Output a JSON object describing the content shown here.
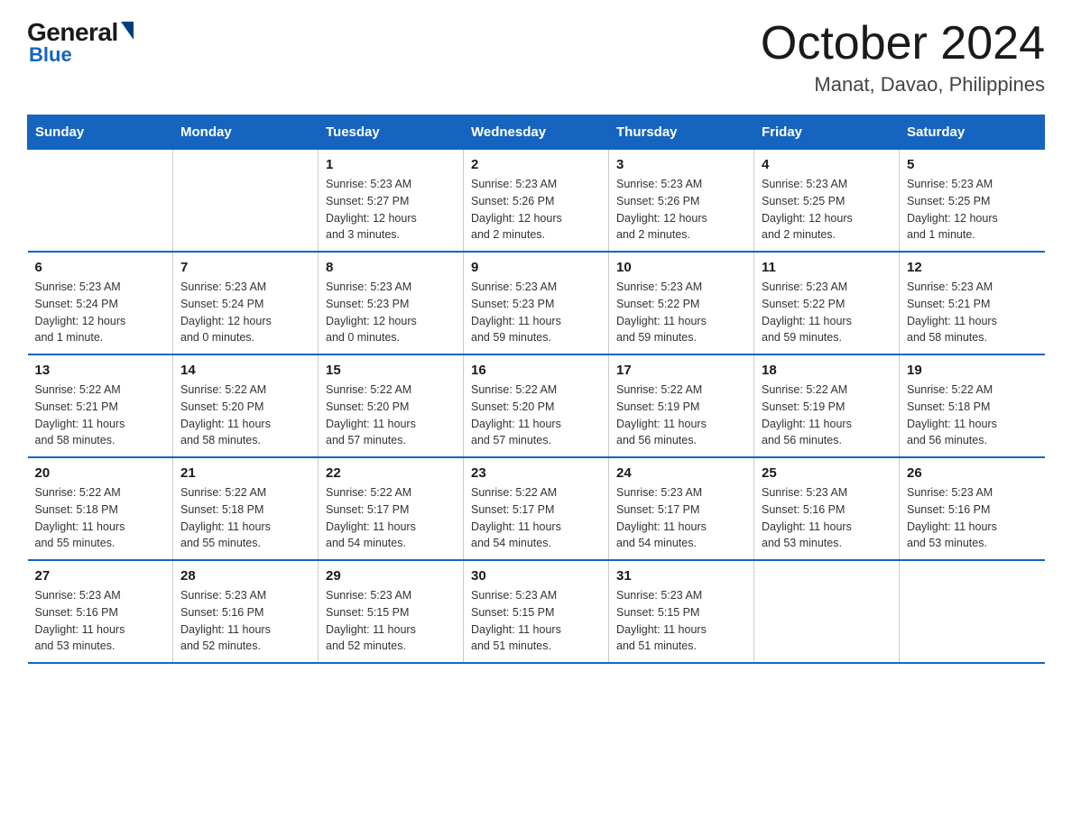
{
  "logo": {
    "general": "General",
    "blue": "Blue"
  },
  "title": "October 2024",
  "subtitle": "Manat, Davao, Philippines",
  "days_header": [
    "Sunday",
    "Monday",
    "Tuesday",
    "Wednesday",
    "Thursday",
    "Friday",
    "Saturday"
  ],
  "weeks": [
    [
      {
        "day": "",
        "info": ""
      },
      {
        "day": "",
        "info": ""
      },
      {
        "day": "1",
        "info": "Sunrise: 5:23 AM\nSunset: 5:27 PM\nDaylight: 12 hours\nand 3 minutes."
      },
      {
        "day": "2",
        "info": "Sunrise: 5:23 AM\nSunset: 5:26 PM\nDaylight: 12 hours\nand 2 minutes."
      },
      {
        "day": "3",
        "info": "Sunrise: 5:23 AM\nSunset: 5:26 PM\nDaylight: 12 hours\nand 2 minutes."
      },
      {
        "day": "4",
        "info": "Sunrise: 5:23 AM\nSunset: 5:25 PM\nDaylight: 12 hours\nand 2 minutes."
      },
      {
        "day": "5",
        "info": "Sunrise: 5:23 AM\nSunset: 5:25 PM\nDaylight: 12 hours\nand 1 minute."
      }
    ],
    [
      {
        "day": "6",
        "info": "Sunrise: 5:23 AM\nSunset: 5:24 PM\nDaylight: 12 hours\nand 1 minute."
      },
      {
        "day": "7",
        "info": "Sunrise: 5:23 AM\nSunset: 5:24 PM\nDaylight: 12 hours\nand 0 minutes."
      },
      {
        "day": "8",
        "info": "Sunrise: 5:23 AM\nSunset: 5:23 PM\nDaylight: 12 hours\nand 0 minutes."
      },
      {
        "day": "9",
        "info": "Sunrise: 5:23 AM\nSunset: 5:23 PM\nDaylight: 11 hours\nand 59 minutes."
      },
      {
        "day": "10",
        "info": "Sunrise: 5:23 AM\nSunset: 5:22 PM\nDaylight: 11 hours\nand 59 minutes."
      },
      {
        "day": "11",
        "info": "Sunrise: 5:23 AM\nSunset: 5:22 PM\nDaylight: 11 hours\nand 59 minutes."
      },
      {
        "day": "12",
        "info": "Sunrise: 5:23 AM\nSunset: 5:21 PM\nDaylight: 11 hours\nand 58 minutes."
      }
    ],
    [
      {
        "day": "13",
        "info": "Sunrise: 5:22 AM\nSunset: 5:21 PM\nDaylight: 11 hours\nand 58 minutes."
      },
      {
        "day": "14",
        "info": "Sunrise: 5:22 AM\nSunset: 5:20 PM\nDaylight: 11 hours\nand 58 minutes."
      },
      {
        "day": "15",
        "info": "Sunrise: 5:22 AM\nSunset: 5:20 PM\nDaylight: 11 hours\nand 57 minutes."
      },
      {
        "day": "16",
        "info": "Sunrise: 5:22 AM\nSunset: 5:20 PM\nDaylight: 11 hours\nand 57 minutes."
      },
      {
        "day": "17",
        "info": "Sunrise: 5:22 AM\nSunset: 5:19 PM\nDaylight: 11 hours\nand 56 minutes."
      },
      {
        "day": "18",
        "info": "Sunrise: 5:22 AM\nSunset: 5:19 PM\nDaylight: 11 hours\nand 56 minutes."
      },
      {
        "day": "19",
        "info": "Sunrise: 5:22 AM\nSunset: 5:18 PM\nDaylight: 11 hours\nand 56 minutes."
      }
    ],
    [
      {
        "day": "20",
        "info": "Sunrise: 5:22 AM\nSunset: 5:18 PM\nDaylight: 11 hours\nand 55 minutes."
      },
      {
        "day": "21",
        "info": "Sunrise: 5:22 AM\nSunset: 5:18 PM\nDaylight: 11 hours\nand 55 minutes."
      },
      {
        "day": "22",
        "info": "Sunrise: 5:22 AM\nSunset: 5:17 PM\nDaylight: 11 hours\nand 54 minutes."
      },
      {
        "day": "23",
        "info": "Sunrise: 5:22 AM\nSunset: 5:17 PM\nDaylight: 11 hours\nand 54 minutes."
      },
      {
        "day": "24",
        "info": "Sunrise: 5:23 AM\nSunset: 5:17 PM\nDaylight: 11 hours\nand 54 minutes."
      },
      {
        "day": "25",
        "info": "Sunrise: 5:23 AM\nSunset: 5:16 PM\nDaylight: 11 hours\nand 53 minutes."
      },
      {
        "day": "26",
        "info": "Sunrise: 5:23 AM\nSunset: 5:16 PM\nDaylight: 11 hours\nand 53 minutes."
      }
    ],
    [
      {
        "day": "27",
        "info": "Sunrise: 5:23 AM\nSunset: 5:16 PM\nDaylight: 11 hours\nand 53 minutes."
      },
      {
        "day": "28",
        "info": "Sunrise: 5:23 AM\nSunset: 5:16 PM\nDaylight: 11 hours\nand 52 minutes."
      },
      {
        "day": "29",
        "info": "Sunrise: 5:23 AM\nSunset: 5:15 PM\nDaylight: 11 hours\nand 52 minutes."
      },
      {
        "day": "30",
        "info": "Sunrise: 5:23 AM\nSunset: 5:15 PM\nDaylight: 11 hours\nand 51 minutes."
      },
      {
        "day": "31",
        "info": "Sunrise: 5:23 AM\nSunset: 5:15 PM\nDaylight: 11 hours\nand 51 minutes."
      },
      {
        "day": "",
        "info": ""
      },
      {
        "day": "",
        "info": ""
      }
    ]
  ]
}
